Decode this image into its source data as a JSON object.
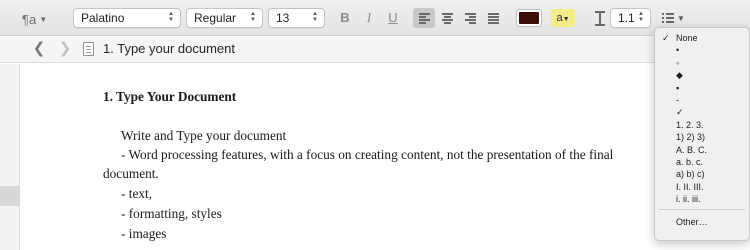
{
  "toolbar": {
    "paragraph_style_glyph": "¶a",
    "font_family": "Palatino",
    "typeface": "Regular",
    "font_size": "13",
    "bold_label": "B",
    "italic_label": "I",
    "underline_label": "U",
    "text_color": "#3a0c06",
    "highlight_label": "a",
    "highlight_color": "#f3ed87",
    "line_spacing": "1.1",
    "active_alignment": "left"
  },
  "titlebar": {
    "document_title": "1. Type your document"
  },
  "document": {
    "heading": "1. Type Your Document",
    "lines": [
      "Write and Type your document",
      "- Word processing features, with a focus on creating content, not the presentation of the final",
      "document.",
      "- text,",
      "- formatting, styles",
      "- images"
    ]
  },
  "list_menu": {
    "items": [
      {
        "label": "None",
        "checked": true
      },
      {
        "label": "•",
        "checked": false
      },
      {
        "label": "◦",
        "checked": false
      },
      {
        "label": "◆",
        "checked": false
      },
      {
        "label": "▪",
        "checked": false
      },
      {
        "label": "-",
        "checked": false
      },
      {
        "label": "✓",
        "checked": false
      },
      {
        "label": "1.  2.  3.",
        "checked": false
      },
      {
        "label": "1)  2)  3)",
        "checked": false
      },
      {
        "label": "A.  B.  C.",
        "checked": false
      },
      {
        "label": "a.  b.  c.",
        "checked": false
      },
      {
        "label": "a)  b)  c)",
        "checked": false
      },
      {
        "label": "I.  II.  III.",
        "checked": false
      },
      {
        "label": "i.  ii.  iii.",
        "checked": false
      }
    ],
    "other_label": "Other…",
    "check_glyph": "✓"
  }
}
